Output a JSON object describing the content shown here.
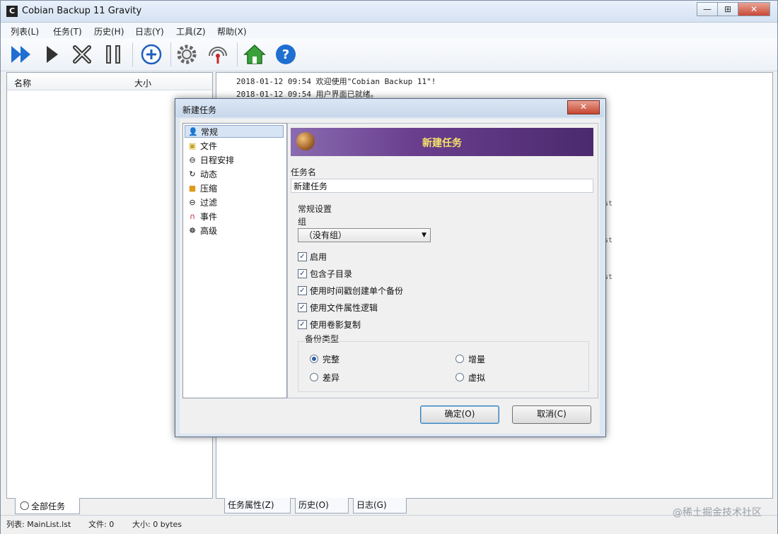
{
  "window": {
    "title": "Cobian Backup 11 Gravity",
    "win_minimize": "—",
    "win_maximize": "⊞",
    "win_close": "✕"
  },
  "menu": [
    "列表(L)",
    "任务(T)",
    "历史(H)",
    "日志(Y)",
    "工具(Z)",
    "帮助(X)"
  ],
  "toolbar": {
    "icons": [
      "run-all-icon",
      "run-icon",
      "cancel-icon",
      "pause-icon",
      "add-task-icon",
      "settings-icon",
      "status-icon",
      "home-icon",
      "help-icon"
    ]
  },
  "task_list": {
    "col_name": "名称",
    "col_size": "大小"
  },
  "log": {
    "lines": [
      "2018-01-12 09:54 欢迎使用\"Cobian Backup 11\"!",
      "2018-01-12 09:54 用户界面已就绪。"
    ],
    "side_labels": [
      "st",
      "st",
      "st"
    ]
  },
  "bottom_tabs": {
    "all_tasks": "全部任务",
    "task_props": "任务属性(Z)",
    "history": "历史(O)",
    "log": "日志(G)"
  },
  "status": {
    "list": "列表: MainList.lst",
    "files": "文件: 0",
    "size": "大小: 0 bytes"
  },
  "watermark": "@稀土掘金技术社区",
  "dialog": {
    "title": "新建任务",
    "close": "✕",
    "nav": [
      {
        "label": "常规",
        "icon": "general-icon",
        "selected": true
      },
      {
        "label": "文件",
        "icon": "files-icon"
      },
      {
        "label": "日程安排",
        "icon": "schedule-icon"
      },
      {
        "label": "动态",
        "icon": "dynamic-icon"
      },
      {
        "label": "压缩",
        "icon": "archive-icon"
      },
      {
        "label": "过滤",
        "icon": "filter-icon"
      },
      {
        "label": "事件",
        "icon": "events-icon"
      },
      {
        "label": "高级",
        "icon": "advanced-icon"
      }
    ],
    "banner_title": "新建任务",
    "task_name_label": "任务名",
    "task_name_value": "新建任务",
    "general_settings": "常规设置",
    "group_label": "组",
    "group_value": "（没有组）",
    "checkboxes": [
      {
        "label": "启用",
        "checked": true
      },
      {
        "label": "包含子目录",
        "checked": true
      },
      {
        "label": "使用时间戳创建单个备份",
        "checked": true
      },
      {
        "label": "使用文件属性逻辑",
        "checked": true
      },
      {
        "label": "使用卷影复制",
        "checked": true
      }
    ],
    "backup_type_label": "备份类型",
    "radios": [
      {
        "label": "完整",
        "checked": true
      },
      {
        "label": "增量",
        "checked": false
      },
      {
        "label": "差异",
        "checked": false
      },
      {
        "label": "虚拟",
        "checked": false
      }
    ],
    "ok": "确定(O)",
    "cancel": "取消(C)"
  }
}
